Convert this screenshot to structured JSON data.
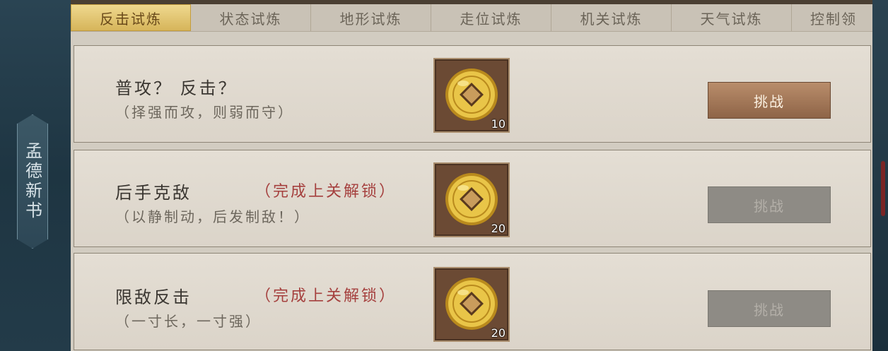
{
  "side_tab": {
    "label": "孟德新书"
  },
  "tabs": [
    {
      "label": "反击试炼",
      "active": true
    },
    {
      "label": "状态试炼",
      "active": false
    },
    {
      "label": "地形试炼",
      "active": false
    },
    {
      "label": "走位试炼",
      "active": false
    },
    {
      "label": "机关试炼",
      "active": false
    },
    {
      "label": "天气试炼",
      "active": false
    },
    {
      "label": "控制领",
      "active": false
    }
  ],
  "trials": [
    {
      "title": "普攻？ 反击？",
      "subtitle": "（择强而攻，则弱而守）",
      "lock_note": "",
      "reward_count": "10",
      "button_label": "挑战",
      "button_enabled": true
    },
    {
      "title": "后手克敌",
      "subtitle": "（以静制动，后发制敌！）",
      "lock_note": "（完成上关解锁）",
      "reward_count": "20",
      "button_label": "挑战",
      "button_enabled": false
    },
    {
      "title": "限敌反击",
      "subtitle": "（一寸长，一寸强）",
      "lock_note": "（完成上关解锁）",
      "reward_count": "20",
      "button_label": "挑战",
      "button_enabled": false
    }
  ],
  "icons": {
    "reward": "gold-coin-icon"
  },
  "colors": {
    "active_tab": "#d6b55a",
    "lock_note": "#a5403e",
    "button_enabled": "#8e6447",
    "button_disabled": "#8e8b85"
  }
}
